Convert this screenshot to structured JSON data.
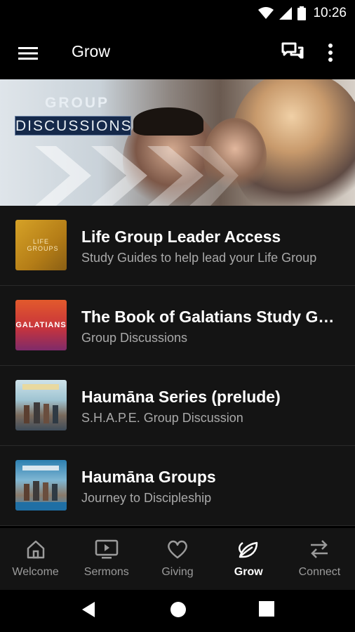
{
  "status_bar": {
    "time": "10:26"
  },
  "toolbar": {
    "title": "Grow"
  },
  "hero": {
    "line1": "GROUP",
    "line2": "DISCUSSIONS"
  },
  "items": [
    {
      "title": "Life Group Leader Access",
      "subtitle": "Study Guides to help lead your Life Group",
      "thumb_text": "LIFE GROUPS"
    },
    {
      "title": " The Book of Galatians Study Gui…",
      "subtitle": "Group Discussions",
      "thumb_text": "GALATIANS"
    },
    {
      "title": "Haumāna Series (prelude)",
      "subtitle": "S.H.A.P.E. Group Discussion",
      "thumb_text": ""
    },
    {
      "title": "Haumāna Groups",
      "subtitle": "Journey to Discipleship",
      "thumb_text": ""
    }
  ],
  "bottom_nav": [
    {
      "label": "Welcome",
      "icon": "home-icon"
    },
    {
      "label": "Sermons",
      "icon": "video-icon"
    },
    {
      "label": "Giving",
      "icon": "heart-icon"
    },
    {
      "label": "Grow",
      "icon": "leaf-icon",
      "active": true
    },
    {
      "label": "Connect",
      "icon": "swap-arrows-icon"
    }
  ],
  "colors": {
    "background": "#141414",
    "appbar": "#000000",
    "subtitle": "#a9a9a9",
    "inactive_nav": "#9b9b9b"
  }
}
